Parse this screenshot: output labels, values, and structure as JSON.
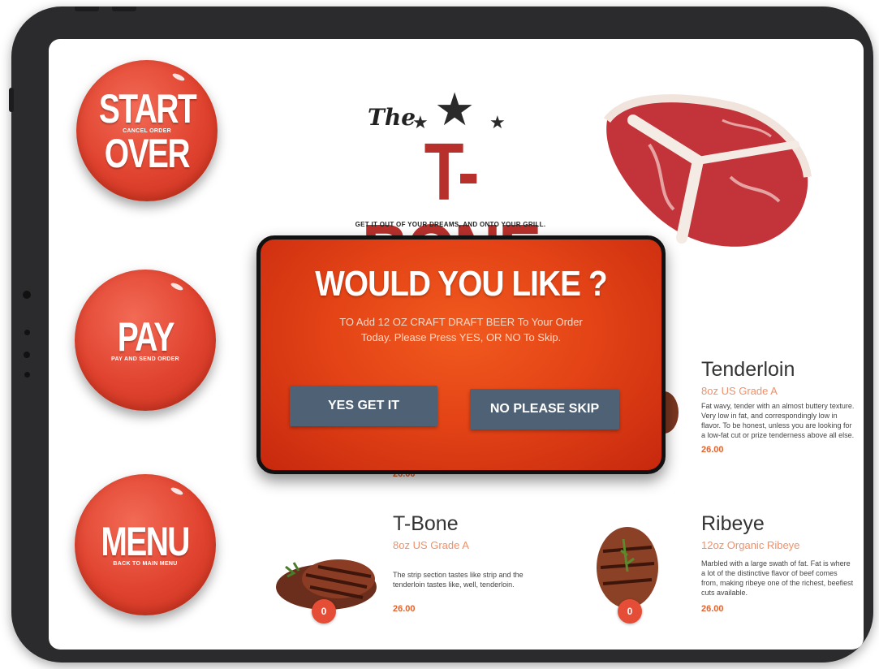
{
  "sidebar": {
    "start_over": {
      "title_line1": "START",
      "title_line2": "OVER",
      "subtitle": "CANCEL ORDER"
    },
    "pay": {
      "title": "PAY",
      "subtitle": "PAY AND SEND ORDER"
    },
    "menu": {
      "title": "MENU",
      "subtitle": "BACK TO MAIN MENU"
    }
  },
  "logo": {
    "script": "The",
    "name": "T-BONE",
    "tagline": "GET IT OUT OF YOUR DREAMS, AND ONTO YOUR GRILL."
  },
  "modal": {
    "heading": "WOULD YOU LIKE ?",
    "message_line1": "TO Add 12 OZ CRAFT DRAFT BEER To Your Order",
    "message_line2": "Today. Please Press YES, OR NO To Skip.",
    "yes_label": "YES GET IT",
    "no_label": "NO PLEASE SKIP"
  },
  "menu_items": [
    {
      "name": "Tenderloin",
      "grade": "8oz US Grade A",
      "description": "Fat wavy, tender with an almost buttery texture. Very low in fat, and correspondingly low in flavor. To be honest, unless you are looking for a low-fat cut or prize tenderness above all else.",
      "price": "26.00"
    },
    {
      "name": "T-Bone",
      "grade": "8oz US Grade A",
      "description": "The strip section tastes like strip and the tenderloin tastes like, well, tenderloin.",
      "price": "26.00",
      "qty": "0"
    },
    {
      "name": "Ribeye",
      "grade": "12oz Organic Ribeye",
      "description": "Marbled with a large swath of fat. Fat is where a lot of the distinctive flavor of beef comes from, making ribeye one of the richest, beefiest cuts available.",
      "price": "26.00",
      "qty": "0"
    }
  ],
  "hidden_item_price": "26.00"
}
